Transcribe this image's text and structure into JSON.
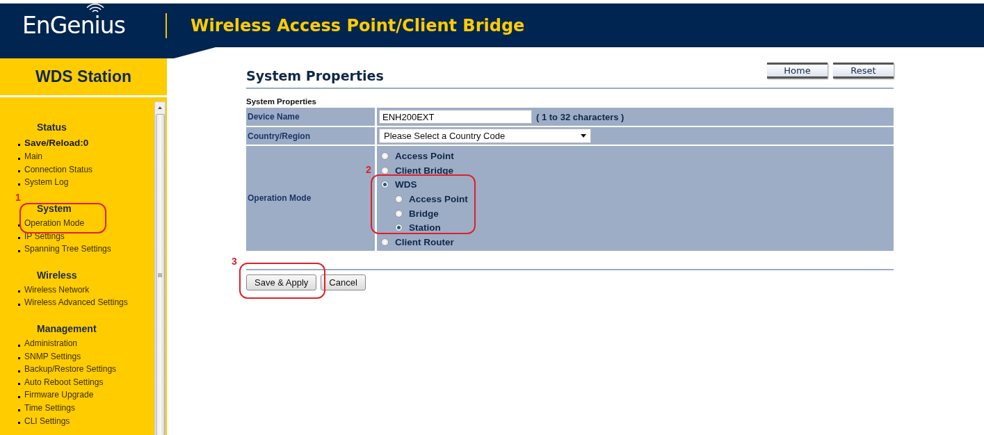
{
  "header": {
    "logo": "EnGenius",
    "title": "Wireless Access Point/Client Bridge"
  },
  "sidebar": {
    "title": "WDS Station",
    "sections": [
      {
        "heading": "Status",
        "items": [
          {
            "label": "Save/Reload:0",
            "bold": true
          },
          {
            "label": "Main",
            "bold": false
          },
          {
            "label": "Connection Status",
            "bold": false
          },
          {
            "label": "System Log",
            "bold": false
          }
        ]
      },
      {
        "heading": "System",
        "items": [
          {
            "label": "Operation Mode",
            "bold": false
          },
          {
            "label": "IP Settings",
            "bold": false
          },
          {
            "label": "Spanning Tree Settings",
            "bold": false
          }
        ]
      },
      {
        "heading": "Wireless",
        "items": [
          {
            "label": "Wireless Network",
            "bold": false
          },
          {
            "label": "Wireless Advanced Settings",
            "bold": false
          }
        ]
      },
      {
        "heading": "Management",
        "items": [
          {
            "label": "Administration",
            "bold": false
          },
          {
            "label": "SNMP Settings",
            "bold": false
          },
          {
            "label": "Backup/Restore Settings",
            "bold": false
          },
          {
            "label": "Auto Reboot Settings",
            "bold": false
          },
          {
            "label": "Firmware Upgrade",
            "bold": false
          },
          {
            "label": "Time Settings",
            "bold": false
          },
          {
            "label": "CLI Settings",
            "bold": false
          }
        ]
      }
    ]
  },
  "page": {
    "title": "System Properties",
    "top_buttons": [
      "Home",
      "Reset"
    ],
    "section_caption": "System Properties",
    "device_name": {
      "label": "Device Name",
      "value": "ENH200EXT",
      "hint": "( 1 to 32 characters )"
    },
    "country": {
      "label": "Country/Region",
      "value": "Please Select a Country Code"
    },
    "operation_mode": {
      "label": "Operation Mode",
      "options": [
        {
          "label": "Access Point",
          "selected": false
        },
        {
          "label": "Client Bridge",
          "selected": false
        },
        {
          "label": "WDS",
          "selected": true,
          "children": [
            {
              "label": "Access Point",
              "selected": false
            },
            {
              "label": "Bridge",
              "selected": false
            },
            {
              "label": "Station",
              "selected": true
            }
          ]
        },
        {
          "label": "Client Router",
          "selected": false
        }
      ]
    },
    "buttons": [
      "Save & Apply",
      "Cancel"
    ]
  },
  "annotations": [
    {
      "number": "1"
    },
    {
      "number": "2"
    },
    {
      "number": "3"
    }
  ]
}
